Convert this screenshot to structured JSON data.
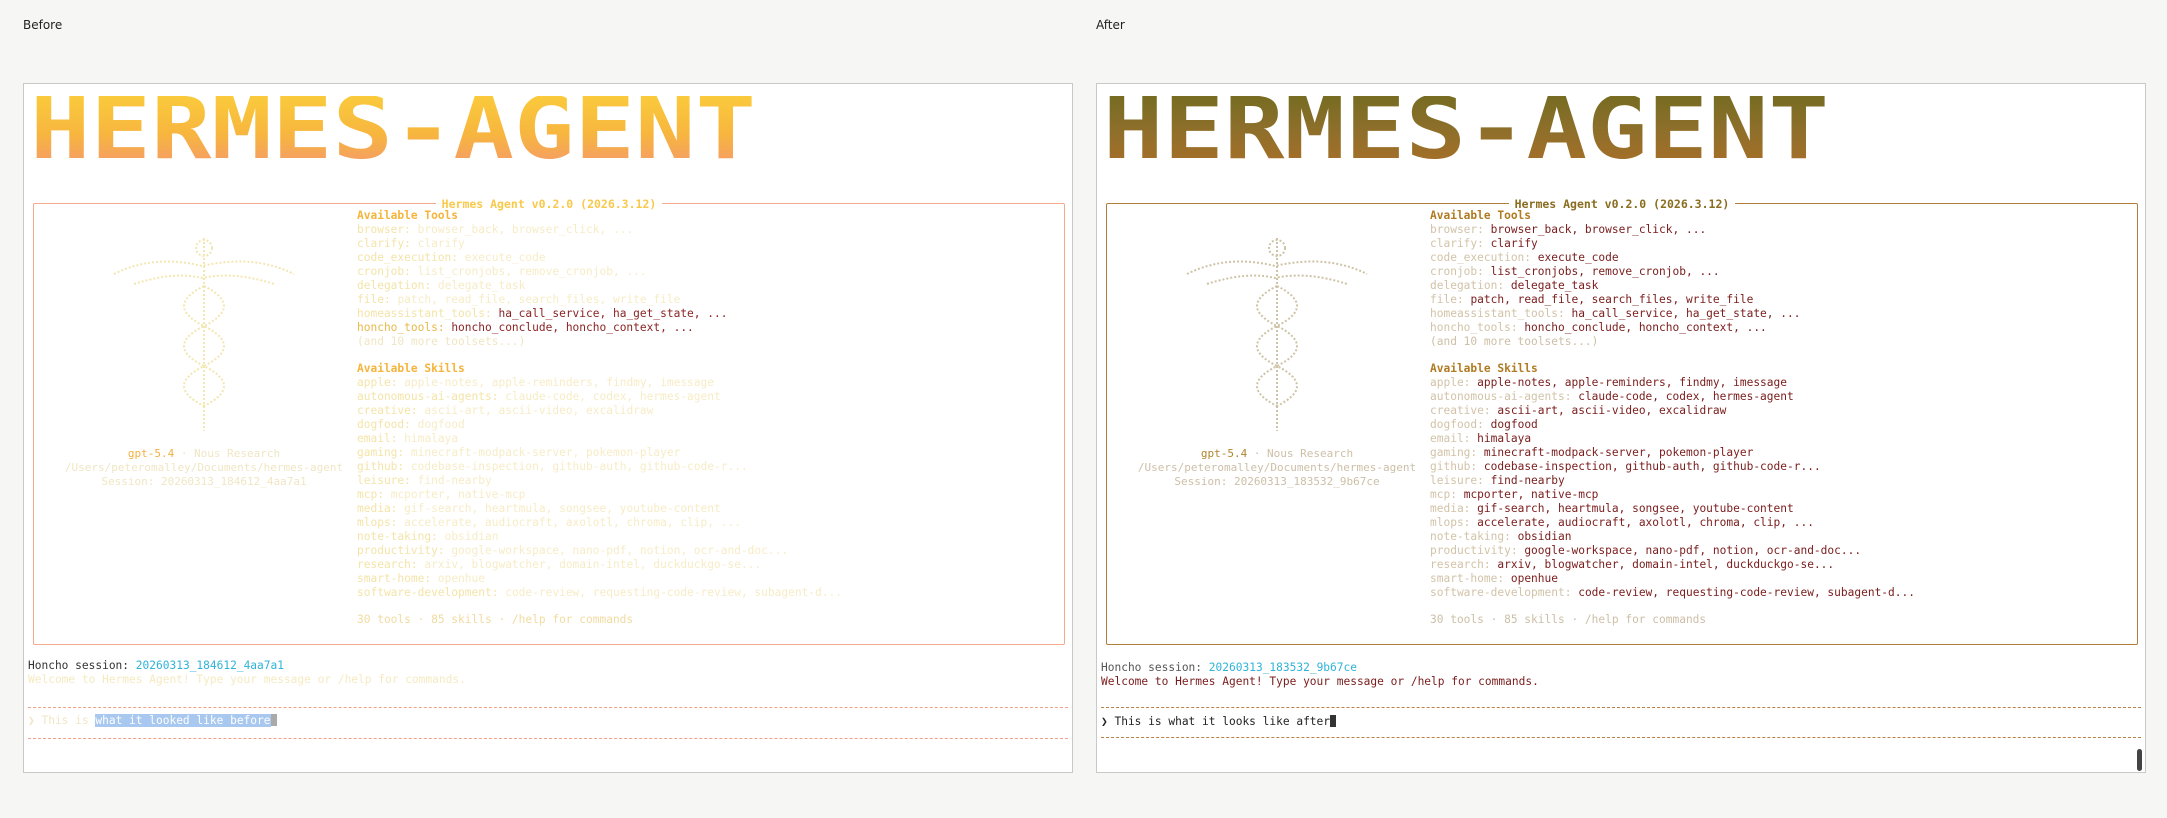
{
  "captions": {
    "before": "Before",
    "after": "After"
  },
  "banner": {
    "title": "Hermes Agent v0.2.0 (2026.3.12)",
    "logo_text": "HERMES-AGENT"
  },
  "tools_header": "Available Tools",
  "skills_header": "Available Skills",
  "more_toolsets": "(and 10 more toolsets...)",
  "footer": "30 tools · 85 skills · /help for commands",
  "tools": [
    {
      "category": "browser:",
      "items": "browser_back, browser_click, ..."
    },
    {
      "category": "clarify:",
      "items": "clarify"
    },
    {
      "category": "code_execution:",
      "items": "execute_code"
    },
    {
      "category": "cronjob:",
      "items": "list_cronjobs, remove_cronjob, ..."
    },
    {
      "category": "delegation:",
      "items": "delegate_task"
    },
    {
      "category": "file:",
      "items": "patch, read_file, search_files, write_file"
    },
    {
      "category": "homeassistant_tools:",
      "items": "ha_call_service, ha_get_state, ..."
    },
    {
      "category": "honcho_tools:",
      "items": "honcho_conclude, honcho_context, ..."
    }
  ],
  "skills": [
    {
      "category": "apple:",
      "items": "apple-notes, apple-reminders, findmy, imessage"
    },
    {
      "category": "autonomous-ai-agents:",
      "items": "claude-code, codex, hermes-agent"
    },
    {
      "category": "creative:",
      "items": "ascii-art, ascii-video, excalidraw"
    },
    {
      "category": "dogfood:",
      "items": "dogfood"
    },
    {
      "category": "email:",
      "items": "himalaya"
    },
    {
      "category": "gaming:",
      "items": "minecraft-modpack-server, pokemon-player"
    },
    {
      "category": "github:",
      "items": "codebase-inspection, github-auth, github-code-r..."
    },
    {
      "category": "leisure:",
      "items": "find-nearby"
    },
    {
      "category": "mcp:",
      "items": "mcporter, native-mcp"
    },
    {
      "category": "media:",
      "items": "gif-search, heartmula, songsee, youtube-content"
    },
    {
      "category": "mlops:",
      "items": "accelerate, audiocraft, axolotl, chroma, clip, ..."
    },
    {
      "category": "note-taking:",
      "items": "obsidian"
    },
    {
      "category": "productivity:",
      "items": "google-workspace, nano-pdf, notion, ocr-and-doc..."
    },
    {
      "category": "research:",
      "items": "arxiv, blogwatcher, domain-intel, duckduckgo-se..."
    },
    {
      "category": "smart-home:",
      "items": "openhue"
    },
    {
      "category": "software-development:",
      "items": "code-review, requesting-code-review, subagent-d..."
    }
  ],
  "model": {
    "name": "gpt-5.4",
    "provider": "· Nous Research",
    "path": "/Users/peteromalley/Documents/hermes-agent"
  },
  "before": {
    "session_line": "Session: 20260313_184612_4aa7a1",
    "honcho_label": "Honcho session:",
    "honcho_id": "20260313_184612_4aa7a1",
    "welcome": "Welcome to Hermes Agent! Type your message or /help for commands.",
    "prompt_faded": "❯ This is",
    "prompt_selected": "what it looked like before"
  },
  "after": {
    "session_line": "Session: 20260313_183532_9b67ce",
    "honcho_label": "Honcho session:",
    "honcho_id": "20260313_183532_9b67ce",
    "welcome": "Welcome to Hermes Agent! Type your message or /help for commands.",
    "prompt": "❯ This is what it looks like after"
  },
  "colors": {
    "before_logo_top": "#fcd33b",
    "before_logo_bottom": "#f4907a",
    "after_logo_top": "#6b6a1e",
    "after_logo_bottom": "#b06f28",
    "session_id": "#2fb3d8",
    "after_value": "#7a1c1c"
  },
  "icons": {
    "prompt": "chevron-prompt-icon",
    "mascot": "caduceus-ascii-icon"
  }
}
